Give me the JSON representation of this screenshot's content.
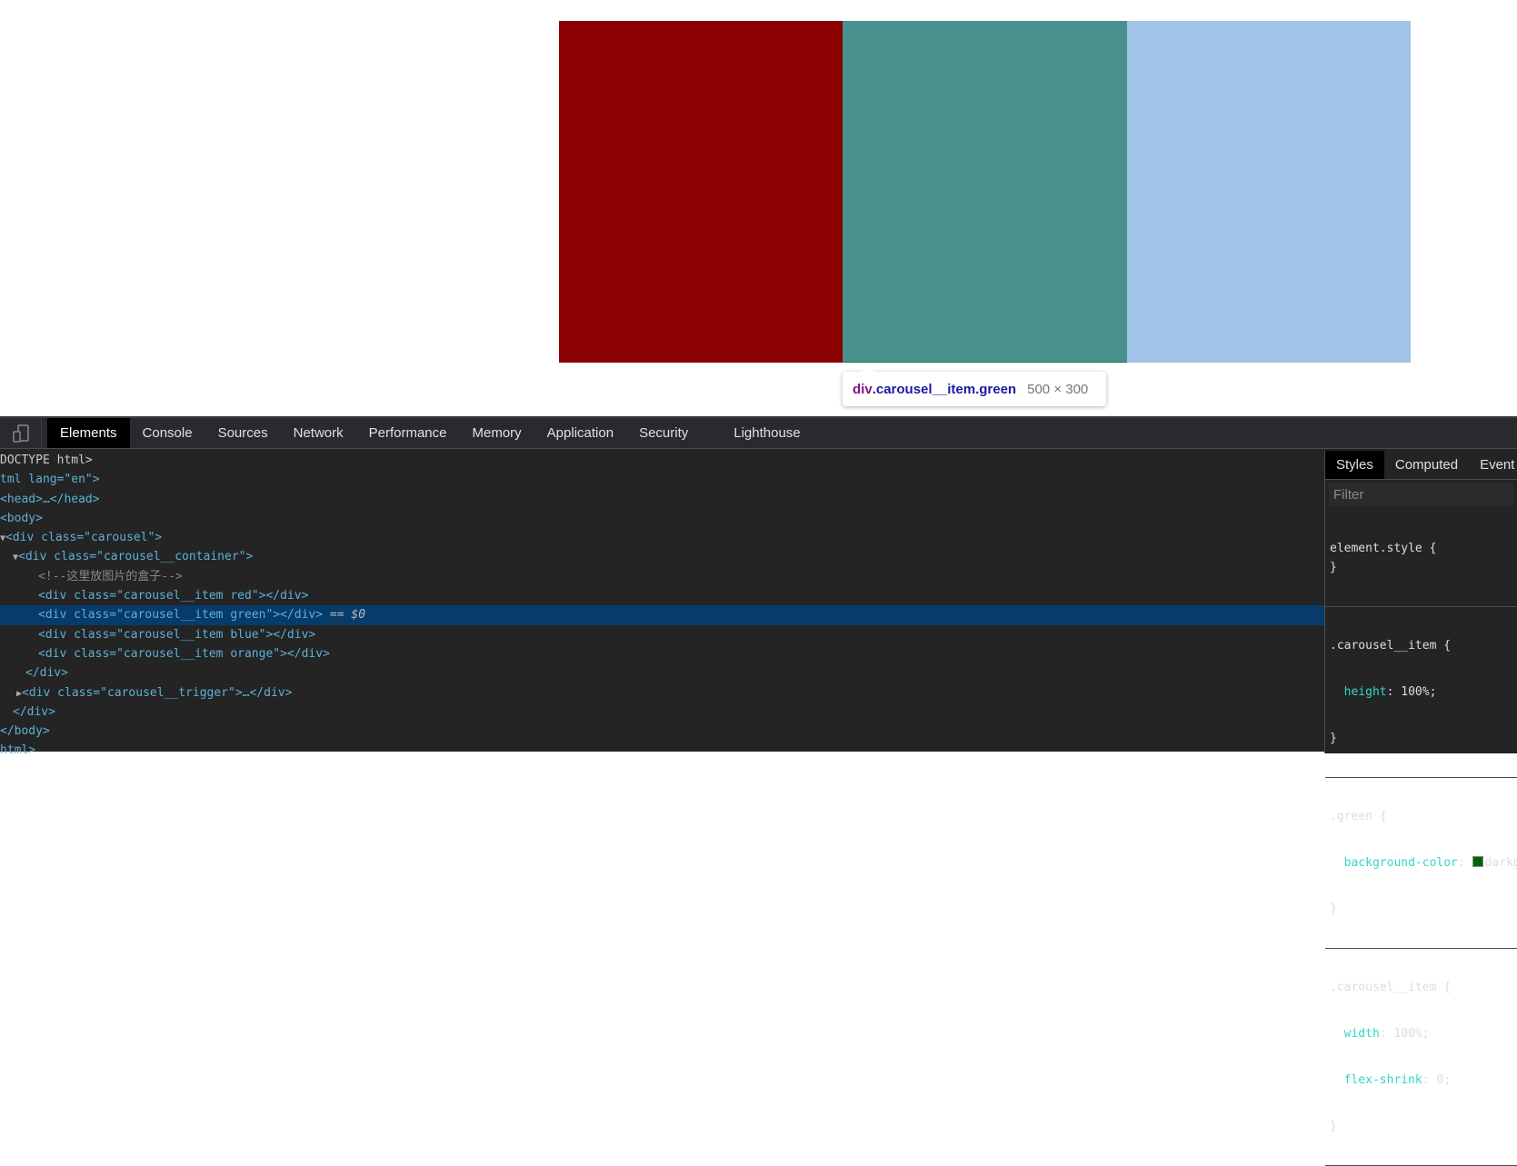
{
  "page": {
    "boxes": [
      {
        "name": "red",
        "color": "#8b0000"
      },
      {
        "name": "green",
        "color": "#4a908f"
      },
      {
        "name": "blue",
        "color": "#a1c4e8"
      }
    ]
  },
  "tooltip": {
    "tag": "div",
    "classes": ".carousel__item.green",
    "size": "500 × 300"
  },
  "devtools": {
    "tabs": [
      "Elements",
      "Console",
      "Sources",
      "Network",
      "Performance",
      "Memory",
      "Application",
      "Security",
      "Lighthouse"
    ],
    "active_tab": "Elements",
    "tree": {
      "doctype": "DOCTYPE html>",
      "html": "tml lang=\"en\">",
      "head": "<head>…</head>",
      "body": "<body>",
      "carousel": "<div class=\"carousel\">",
      "container": "<div class=\"carousel__container\">",
      "comment": "<!--这里放图片的盒子-->",
      "item_red": "<div class=\"carousel__item red\"></div>",
      "item_green": "<div class=\"carousel__item green\"></div>",
      "selected_marker": " == $0",
      "item_blue": "<div class=\"carousel__item blue\"></div>",
      "item_orange": "<div class=\"carousel__item orange\"></div>",
      "close_div1": "</div>",
      "trigger": "<div class=\"carousel__trigger\">…</div>",
      "close_div2": "</div>",
      "close_body": "</body>",
      "close_html": "html>"
    },
    "styles": {
      "tabs": [
        "Styles",
        "Computed",
        "Event Listeners"
      ],
      "filter_placeholder": "Filter",
      "rules": [
        {
          "selector": "element.style {",
          "props": []
        },
        {
          "selector": ".carousel__item {",
          "props": [
            {
              "name": "height",
              "value": "100%;"
            }
          ]
        },
        {
          "selector": ".green {",
          "props": [
            {
              "name": "background-color",
              "value": "darkgreen;"
            }
          ]
        },
        {
          "selector": ".carousel__item {",
          "props": [
            {
              "name": "width",
              "value": "100%;"
            },
            {
              "name": "flex-shrink",
              "value": "0;"
            }
          ]
        }
      ]
    }
  }
}
